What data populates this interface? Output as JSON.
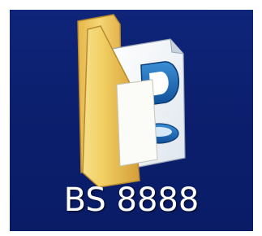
{
  "desktop": {
    "item": {
      "label": "BS 8888",
      "icon": "folder-with-document-icon"
    }
  },
  "colors": {
    "desktop_background": "#0b1f6e",
    "folder_yellow": "#f1cf62",
    "folder_shadow": "#d8a83e",
    "doc_badge_blue": "#1f6fb8",
    "label_text": "#ffffff"
  }
}
